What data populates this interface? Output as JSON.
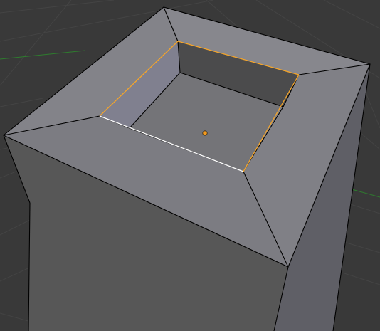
{
  "viewport": {
    "background": "#393939",
    "grid_color": "#444444",
    "x_axis_color": "#2e7d2e"
  },
  "mesh": {
    "object": "extruded-box-with-inset-top",
    "mode": "edit-mode",
    "face_colors": {
      "top_rim": "#828287",
      "inner_floor": "#747478",
      "inner_wall_lit": "#7f7f8d",
      "inner_wall_shadow": "#4a4a4b",
      "outer_front": "#575757",
      "outer_right": "#5f5f66"
    },
    "edge_color": "#000000",
    "selected_edge_color": "#f5a52a",
    "active_edge_color": "#ffffff",
    "origin_color": "#f39a1f"
  }
}
